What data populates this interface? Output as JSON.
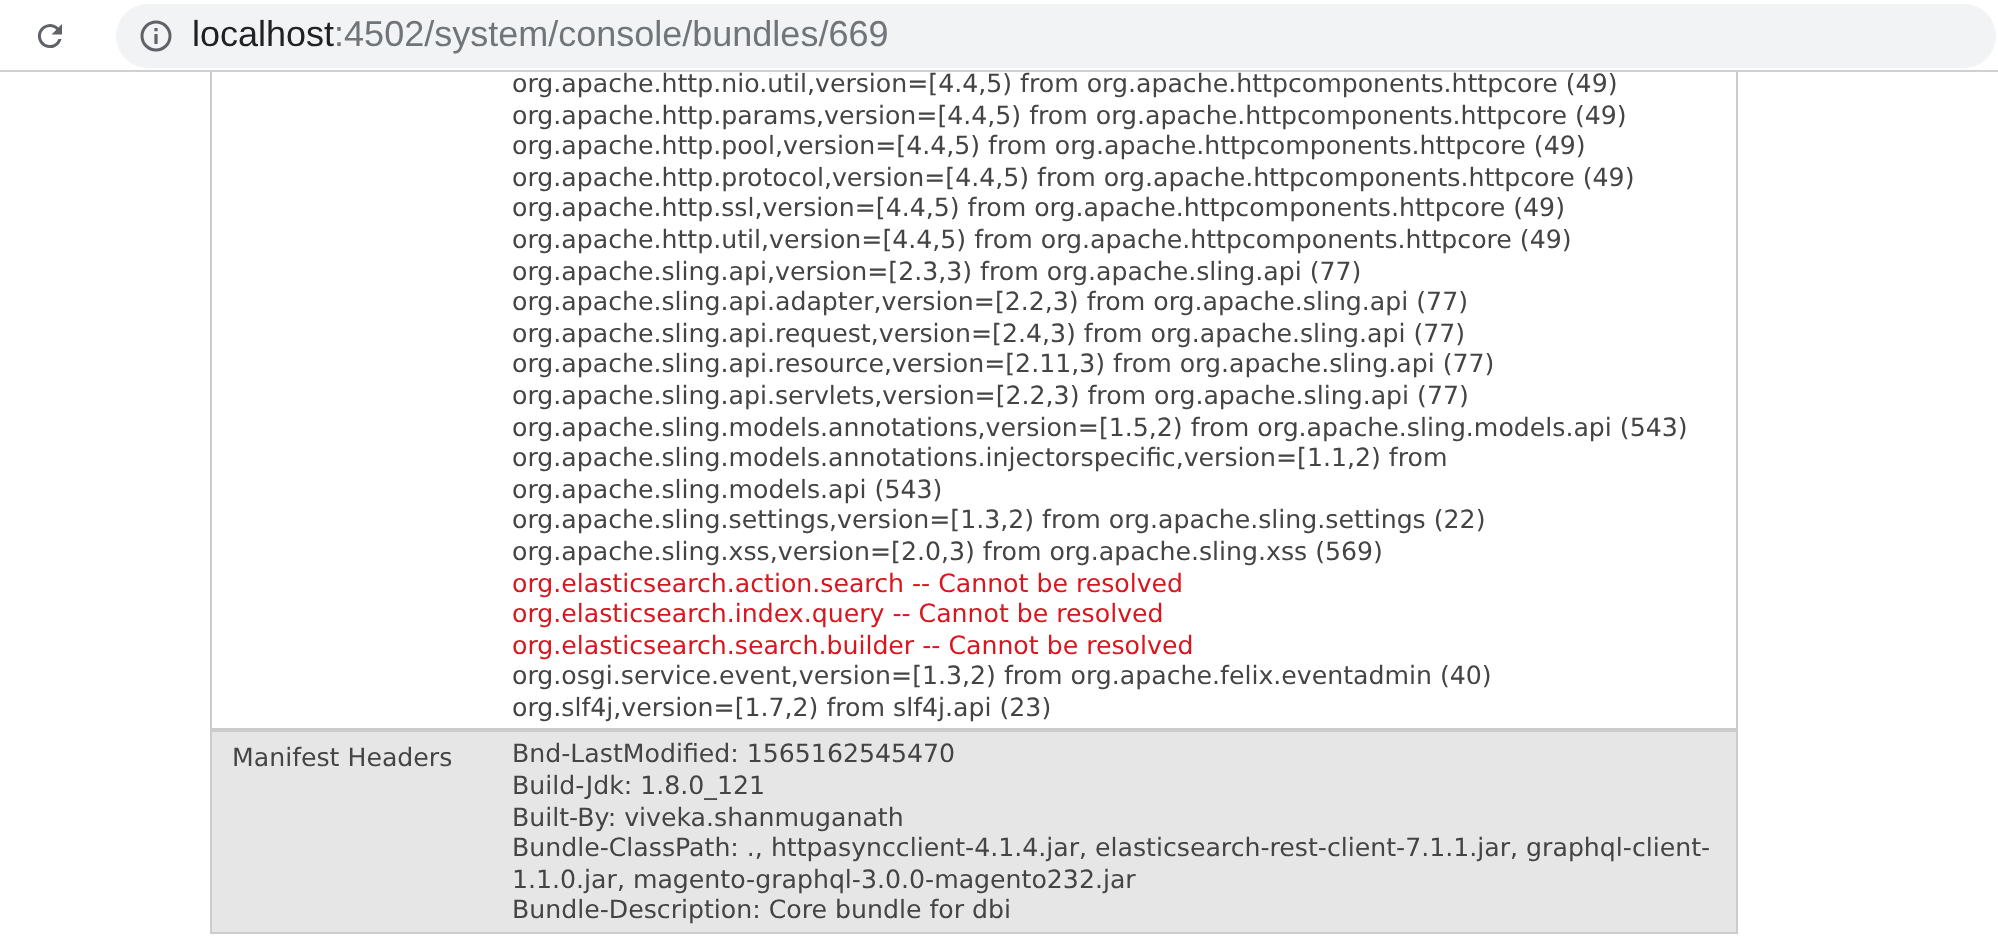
{
  "browser": {
    "url_host": "localhost",
    "url_rest": ":4502/system/console/bundles/669"
  },
  "rows": [
    {
      "entries": [
        {
          "kind": "resolved",
          "text": "org.apache.http.nio.util,version=[4.4,5) from org.apache.httpcomponents.httpcore (49)"
        },
        {
          "kind": "resolved",
          "text": "org.apache.http.params,version=[4.4,5) from org.apache.httpcomponents.httpcore (49)"
        },
        {
          "kind": "resolved",
          "text": "org.apache.http.pool,version=[4.4,5) from org.apache.httpcomponents.httpcore (49)"
        },
        {
          "kind": "resolved",
          "text": "org.apache.http.protocol,version=[4.4,5) from org.apache.httpcomponents.httpcore (49)"
        },
        {
          "kind": "resolved",
          "text": "org.apache.http.ssl,version=[4.4,5) from org.apache.httpcomponents.httpcore (49)"
        },
        {
          "kind": "resolved",
          "text": "org.apache.http.util,version=[4.4,5) from org.apache.httpcomponents.httpcore (49)"
        },
        {
          "kind": "resolved",
          "text": "org.apache.sling.api,version=[2.3,3) from org.apache.sling.api (77)"
        },
        {
          "kind": "resolved",
          "text": "org.apache.sling.api.adapter,version=[2.2,3) from org.apache.sling.api (77)"
        },
        {
          "kind": "resolved",
          "text": "org.apache.sling.api.request,version=[2.4,3) from org.apache.sling.api (77)"
        },
        {
          "kind": "resolved",
          "text": "org.apache.sling.api.resource,version=[2.11,3) from org.apache.sling.api (77)"
        },
        {
          "kind": "resolved",
          "text": "org.apache.sling.api.servlets,version=[2.2,3) from org.apache.sling.api (77)"
        },
        {
          "kind": "resolved",
          "text": "org.apache.sling.models.annotations,version=[1.5,2) from org.apache.sling.models.api (543)"
        },
        {
          "kind": "resolved",
          "text": "org.apache.sling.models.annotations.injectorspecific,version=[1.1,2) from org.apache.sling.models.api (543)"
        },
        {
          "kind": "resolved",
          "text": "org.apache.sling.settings,version=[1.3,2) from org.apache.sling.settings (22)"
        },
        {
          "kind": "resolved",
          "text": "org.apache.sling.xss,version=[2.0,3) from org.apache.sling.xss (569)"
        },
        {
          "kind": "unresolved",
          "text": "org.elasticsearch.action.search -- Cannot be resolved"
        },
        {
          "kind": "unresolved",
          "text": "org.elasticsearch.index.query -- Cannot be resolved"
        },
        {
          "kind": "unresolved",
          "text": "org.elasticsearch.search.builder -- Cannot be resolved"
        },
        {
          "kind": "resolved",
          "text": "org.osgi.service.event,version=[1.3,2) from org.apache.felix.eventadmin (40)"
        },
        {
          "kind": "resolved",
          "text": "org.slf4j,version=[1.7,2) from slf4j.api (23)"
        }
      ]
    },
    {
      "label": "Manifest Headers",
      "entries": [
        {
          "kind": "resolved",
          "text": "Bnd-LastModified: 1565162545470"
        },
        {
          "kind": "resolved",
          "text": "Build-Jdk: 1.8.0_121"
        },
        {
          "kind": "resolved",
          "text": "Built-By: viveka.shanmuganath"
        },
        {
          "kind": "resolved",
          "text": "Bundle-ClassPath: ., httpasyncclient-4.1.4.jar, elasticsearch-rest-client-7.1.1.jar, graphql-client-1.1.0.jar, magento-graphql-3.0.0-magento232.jar"
        },
        {
          "kind": "resolved",
          "text": "Bundle-Description: Core bundle for dbi"
        }
      ]
    }
  ]
}
